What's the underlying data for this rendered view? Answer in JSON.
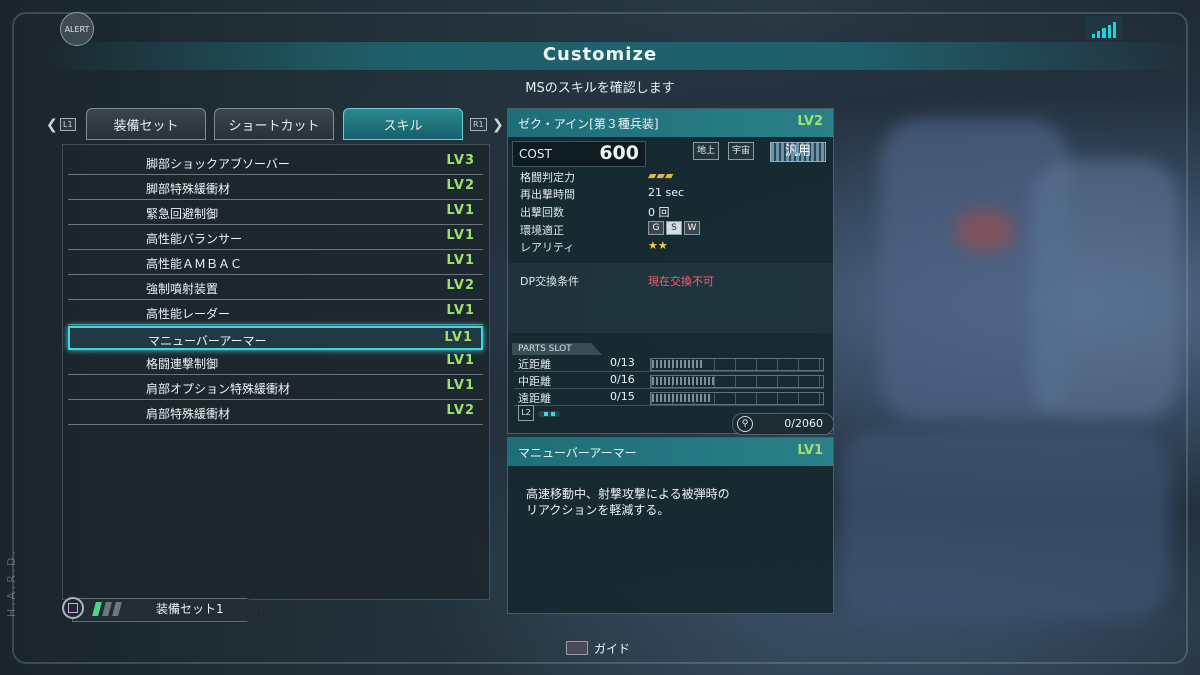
{
  "header": {
    "alert_label": "ALERT",
    "title": "Customize",
    "subtitle": "MSのスキルを確認します"
  },
  "tabs": {
    "left_button": "L1",
    "right_button": "R1",
    "items": [
      {
        "label": "装備セット",
        "active": false
      },
      {
        "label": "ショートカット",
        "active": false
      },
      {
        "label": "スキル",
        "active": true
      }
    ]
  },
  "skills": [
    {
      "name": "脚部ショックアブソーバー",
      "level": "LV3"
    },
    {
      "name": "脚部特殊緩衝材",
      "level": "LV2"
    },
    {
      "name": "緊急回避制御",
      "level": "LV1"
    },
    {
      "name": "高性能バランサー",
      "level": "LV1"
    },
    {
      "name": "高性能ＡＭＢＡＣ",
      "level": "LV1"
    },
    {
      "name": "強制噴射装置",
      "level": "LV2"
    },
    {
      "name": "高性能レーダー",
      "level": "LV1"
    },
    {
      "name": "マニューバーアーマー",
      "level": "LV1",
      "selected": true
    },
    {
      "name": "格闘連撃制御",
      "level": "LV1"
    },
    {
      "name": "肩部オプション特殊緩衝材",
      "level": "LV1"
    },
    {
      "name": "肩部特殊緩衝材",
      "level": "LV2"
    }
  ],
  "loadout": {
    "label": "装備セット1"
  },
  "unit": {
    "name": "ゼク・アイン[第３種兵装]",
    "level": "LV2",
    "cost_label": "COST",
    "cost_value": "600",
    "terrain": [
      "地上",
      "宇宙"
    ],
    "type": "汎用",
    "stats": [
      {
        "label": "格闘判定力",
        "value": ""
      },
      {
        "label": "再出撃時間",
        "value": "21 sec"
      },
      {
        "label": "出撃回数",
        "value": "0 回"
      },
      {
        "label": "環境適正",
        "value": ""
      },
      {
        "label": "レアリティ",
        "value": "★★"
      }
    ],
    "environment_badges": [
      "G",
      "S",
      "W"
    ],
    "dp_label": "DP交換条件",
    "dp_value": "現在交換不可",
    "parts_slot_title": "PARTS SLOT",
    "parts": [
      {
        "label": "近距離",
        "value": "0/13",
        "capacity": 13
      },
      {
        "label": "中距離",
        "value": "0/16",
        "capacity": 16
      },
      {
        "label": "遠距離",
        "value": "0/15",
        "capacity": 15
      }
    ],
    "l2_label": "L2",
    "points": "0/2060"
  },
  "skill_detail": {
    "name": "マニューバーアーマー",
    "level": "LV1",
    "description": "高速移動中、射撃攻撃による被弾時の\nリアクションを軽減する。"
  },
  "footer": {
    "guide_label": "ガイド"
  },
  "side_text": "H.A.R.D.",
  "colors": {
    "accent": "#3fd6df",
    "level": "#9ee06f",
    "warning": "#ff5b6a"
  }
}
